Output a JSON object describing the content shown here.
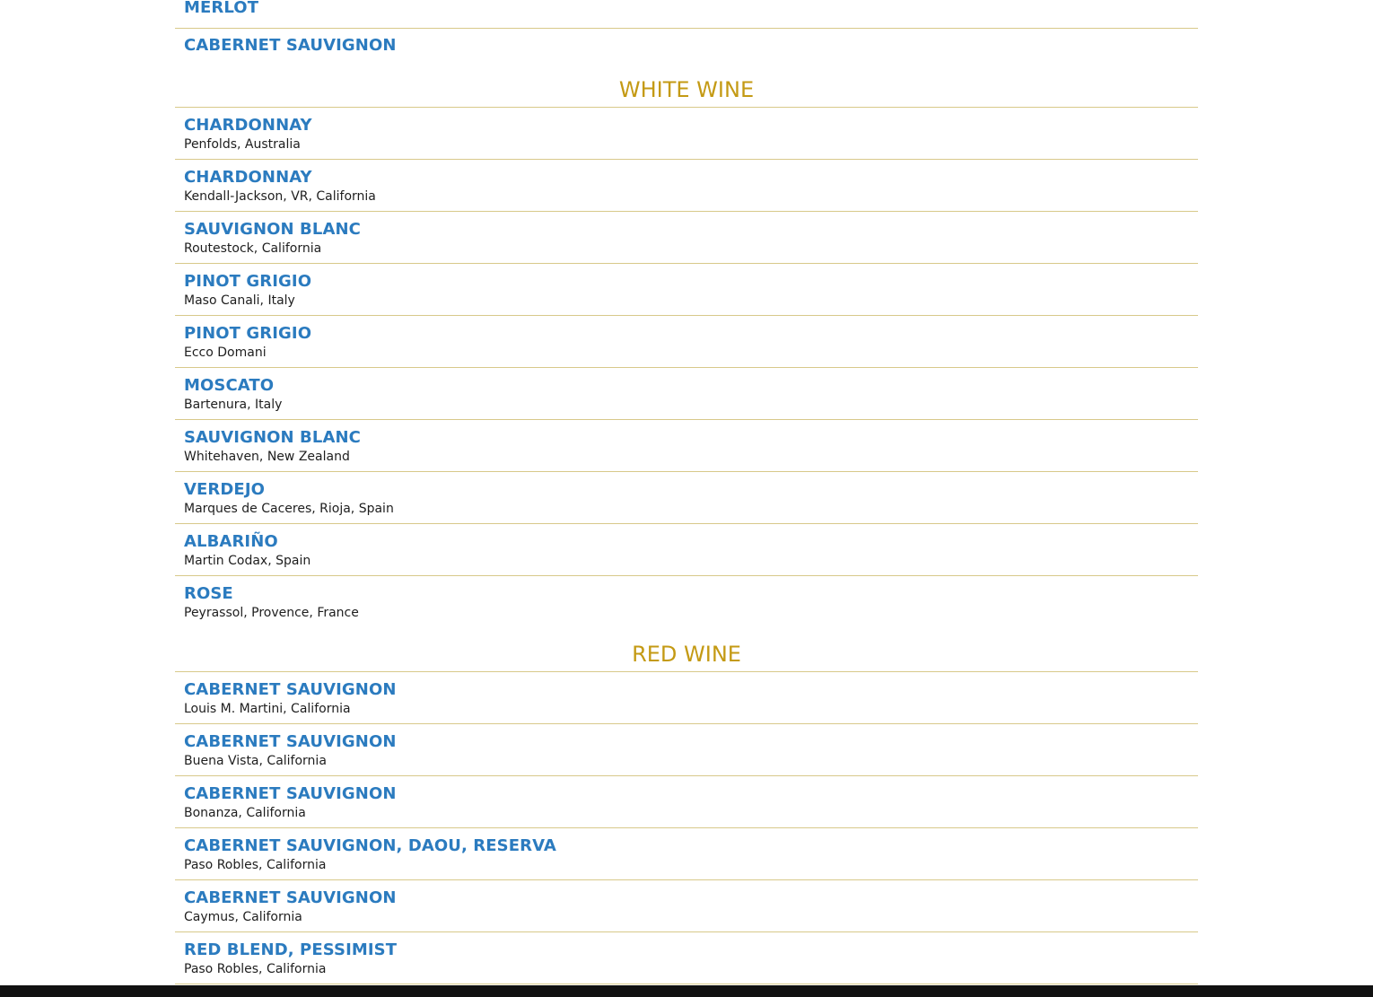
{
  "top_section": {
    "items": [
      {
        "name": "MERLOT"
      },
      {
        "name": "CABERNET SAUVIGNON"
      }
    ]
  },
  "white_wine": {
    "heading": "WHITE WINE",
    "items": [
      {
        "name": "CHARDONNAY",
        "origin": "Penfolds, Australia"
      },
      {
        "name": "CHARDONNAY",
        "origin": "Kendall-Jackson, VR, California"
      },
      {
        "name": "SAUVIGNON BLANC",
        "origin": "Routestock, California"
      },
      {
        "name": "PINOT GRIGIO",
        "origin": "Maso Canali, Italy"
      },
      {
        "name": "PINOT GRIGIO",
        "origin": "Ecco Domani"
      },
      {
        "name": "MOSCATO",
        "origin": "Bartenura, Italy"
      },
      {
        "name": "SAUVIGNON BLANC",
        "origin": "Whitehaven, New Zealand"
      },
      {
        "name": "VERDEJO",
        "origin": "Marques de Caceres, Rioja, Spain"
      },
      {
        "name": "ALBARIÑO",
        "origin": "Martin Codax, Spain"
      },
      {
        "name": "ROSE",
        "origin": "Peyrassol, Provence, France"
      }
    ]
  },
  "red_wine": {
    "heading": "RED WINE",
    "items": [
      {
        "name": "CABERNET SAUVIGNON",
        "origin": "Louis M. Martini, California"
      },
      {
        "name": "CABERNET SAUVIGNON",
        "origin": "Buena Vista, California"
      },
      {
        "name": "CABERNET SAUVIGNON",
        "origin": "Bonanza, California"
      },
      {
        "name": "CABERNET SAUVIGNON, DAOU, RESERVA",
        "origin": "Paso Robles, California"
      },
      {
        "name": "CABERNET SAUVIGNON",
        "origin": "Caymus, California"
      },
      {
        "name": "RED BLEND, PESSIMIST",
        "origin": "Paso Robles, California"
      }
    ]
  },
  "colors": {
    "item_name": "#2b7bbf",
    "section_heading": "#c49a14",
    "divider": "#d8c98a",
    "origin_text": "#1e1e1e",
    "bottom_bar": "#111111"
  }
}
